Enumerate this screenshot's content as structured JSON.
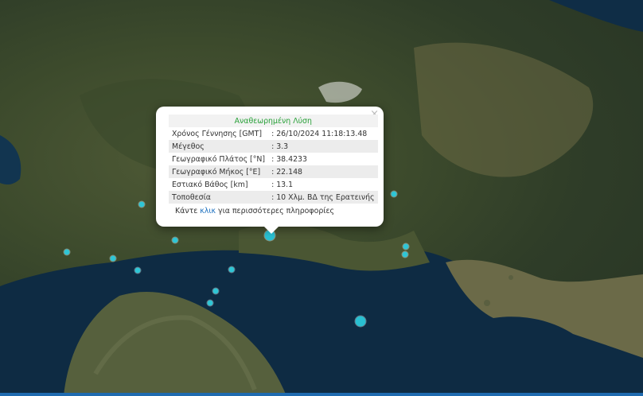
{
  "popup": {
    "title": "Αναθεωρημένη Λύση",
    "rows": [
      {
        "label": "Χρόνος Γέννησης [GMT]",
        "value": ": 26/10/2024 11:18:13.48"
      },
      {
        "label": "Μέγεθος",
        "value": ": 3.3"
      },
      {
        "label": "Γεωγραφικό Πλάτος [°N]",
        "value": ": 38.4233"
      },
      {
        "label": "Γεωγραφικό Μήκος [°E]",
        "value": ": 22.148"
      },
      {
        "label": "Εστιακό Βάθος [km]",
        "value": ": 13.1"
      },
      {
        "label": "Τοποθεσία",
        "value": ": 10 Χλμ. ΒΔ της Ερατεινής"
      }
    ],
    "more_prefix": "Κάντε ",
    "more_link": "κλικ",
    "more_suffix": " για περισσότερες πληροφορίες",
    "close": "×"
  },
  "colors": {
    "marker": "#2fc6d6",
    "sea": "#0e2b43",
    "land": "#4f5a36",
    "link": "#1a6fbf",
    "title": "#2aa13a"
  }
}
